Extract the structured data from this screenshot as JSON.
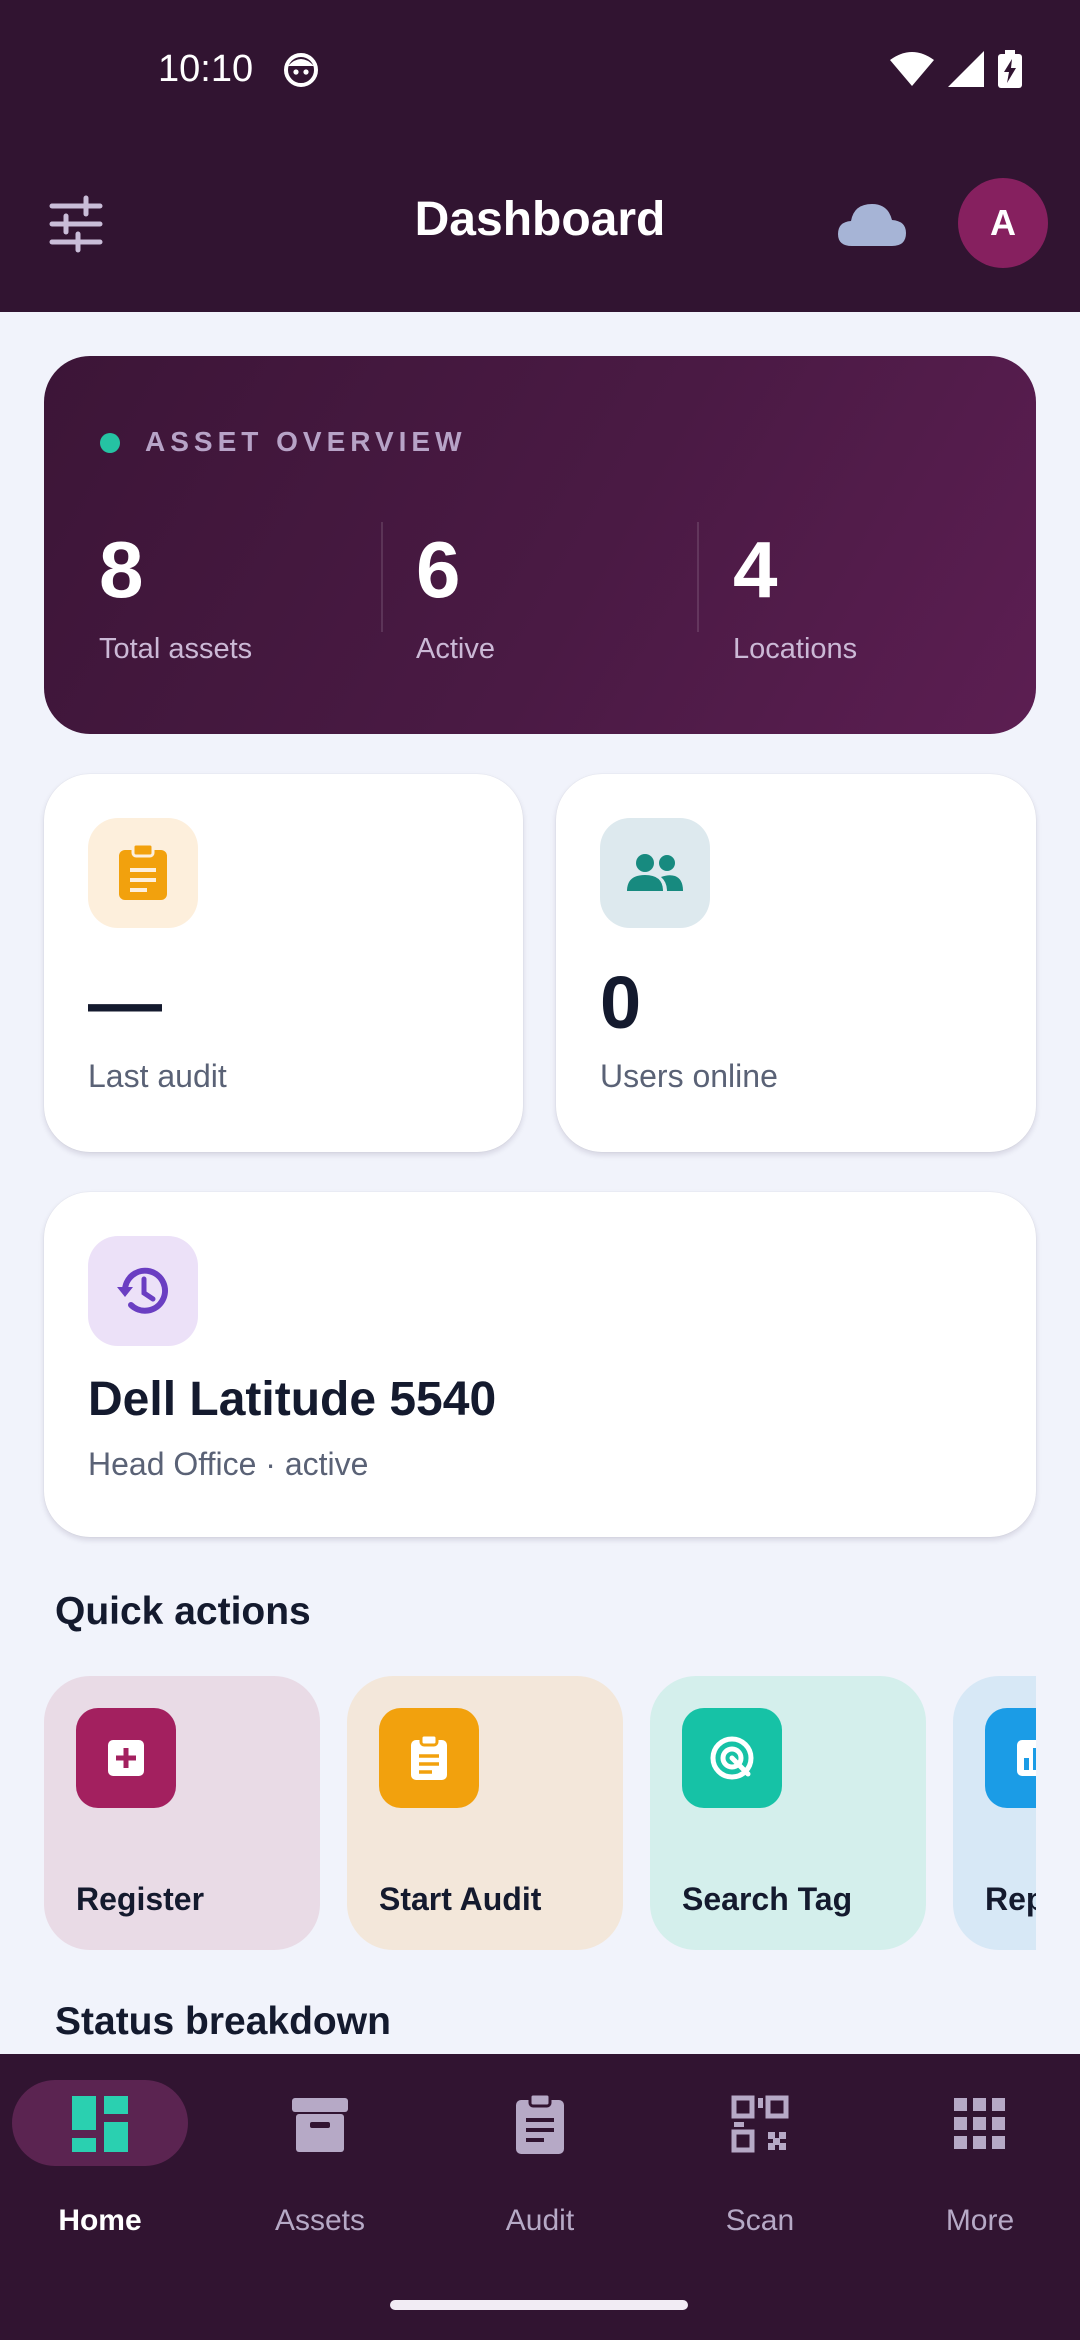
{
  "status_bar": {
    "time": "10:10"
  },
  "header": {
    "title": "Dashboard",
    "avatar_initial": "A"
  },
  "overview": {
    "label": "ASSET OVERVIEW",
    "stats": [
      {
        "value": "8",
        "caption": "Total assets"
      },
      {
        "value": "6",
        "caption": "Active"
      },
      {
        "value": "4",
        "caption": "Locations"
      }
    ]
  },
  "metrics": {
    "last_audit": {
      "value": "—",
      "caption": "Last audit"
    },
    "users_online": {
      "value": "0",
      "caption": "Users online"
    }
  },
  "recent_asset": {
    "name": "Dell Latitude 5540",
    "detail": "Head Office · active"
  },
  "quick_actions": {
    "title": "Quick actions",
    "items": [
      {
        "label": "Register",
        "icon": "plus-box-icon",
        "bg": "#e9dbe6",
        "icon_bg": "#a3205f"
      },
      {
        "label": "Start Audit",
        "icon": "clipboard-icon",
        "bg": "#f3e7da",
        "icon_bg": "#f2a10d"
      },
      {
        "label": "Search Tag",
        "icon": "radar-search-icon",
        "bg": "#d4efec",
        "icon_bg": "#16c2a6"
      },
      {
        "label": "Rep",
        "icon": "chart-bar-icon",
        "bg": "#d7e8f6",
        "icon_bg": "#1b9ce6"
      }
    ]
  },
  "status_breakdown": {
    "title": "Status breakdown"
  },
  "bottom_nav": {
    "items": [
      {
        "label": "Home",
        "icon": "dashboard-icon",
        "active": true
      },
      {
        "label": "Assets",
        "icon": "archive-box-icon",
        "active": false
      },
      {
        "label": "Audit",
        "icon": "clipboard-icon",
        "active": false
      },
      {
        "label": "Scan",
        "icon": "qr-code-icon",
        "active": false
      },
      {
        "label": "More",
        "icon": "grid-dots-icon",
        "active": false
      }
    ]
  },
  "colors": {
    "header_bg": "#311431",
    "accent_teal": "#25c3a3",
    "page_bg": "#f1f3fb"
  }
}
